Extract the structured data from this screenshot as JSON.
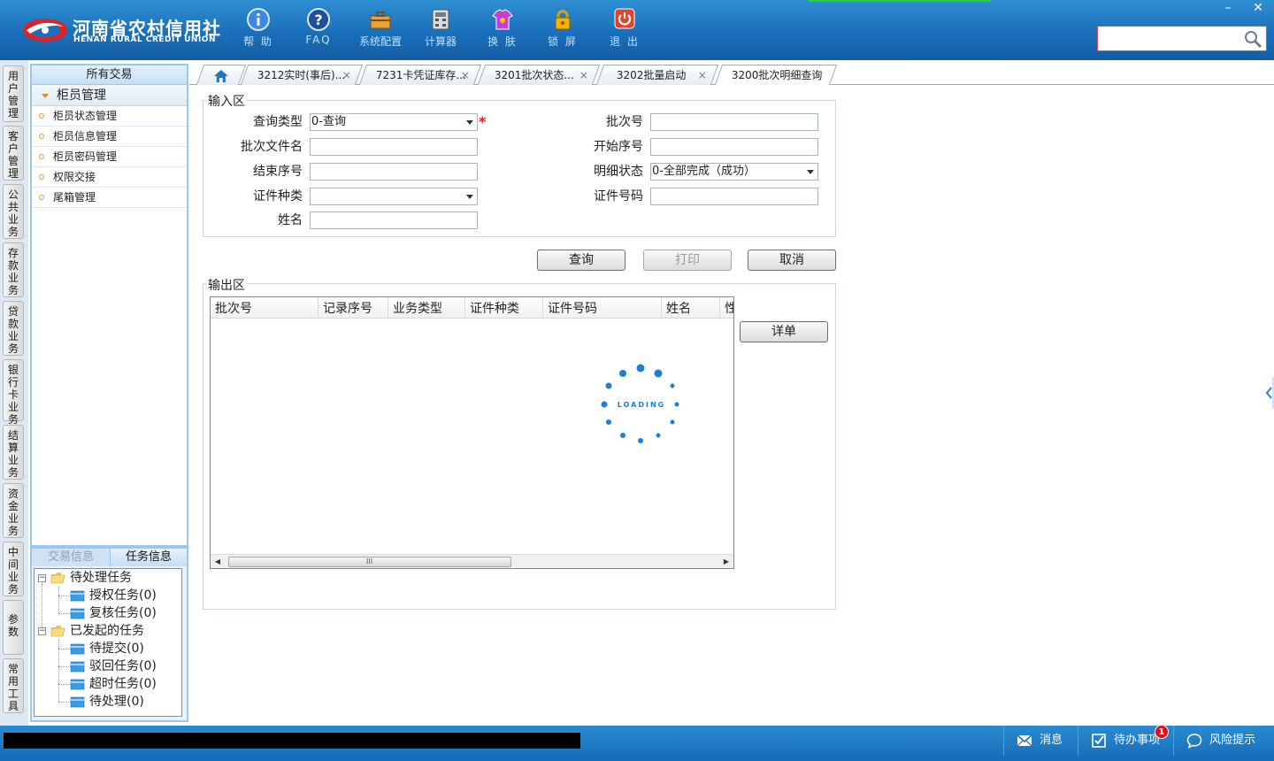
{
  "header": {
    "logo_cn": "河南省农村信用社",
    "logo_en": "HENAN RURAL CREDIT UNION",
    "tools": [
      {
        "label": "帮 助",
        "icon": "info-icon"
      },
      {
        "label": "FAQ",
        "icon": "help-question-icon"
      },
      {
        "label": "系统配置",
        "icon": "toolbox-icon"
      },
      {
        "label": "计算器",
        "icon": "calculator-icon"
      },
      {
        "label": "换 肤",
        "icon": "shirt-icon"
      },
      {
        "label": "锁 屏",
        "icon": "lock-icon"
      },
      {
        "label": "退 出",
        "icon": "power-icon"
      }
    ],
    "window_minimize": "–",
    "window_close": "✕",
    "search": {
      "value": "",
      "placeholder": ""
    }
  },
  "vertical_tabs": [
    "用户管理",
    "客户管理",
    "公共业务",
    "存款业务",
    "贷款业务",
    "银行卡业务",
    "结算业务",
    "资金业务",
    "中间业务",
    "参数",
    "常用工具"
  ],
  "sidebar": {
    "header": "所有交易",
    "group": "柜员管理",
    "items": [
      "柜员状态管理",
      "柜员信息管理",
      "柜员密码管理",
      "权限交接",
      "尾箱管理"
    ]
  },
  "taskpanel": {
    "tabs": [
      "交易信息",
      "任务信息"
    ],
    "active_tab": "任务信息",
    "tree": {
      "pending": {
        "label": "待处理任务",
        "children": [
          "授权任务(0)",
          "复核任务(0)"
        ]
      },
      "started": {
        "label": "已发起的任务",
        "children": [
          "待提交(0)",
          "驳回任务(0)",
          "超时任务(0)",
          "待处理(0)"
        ]
      }
    }
  },
  "tabs": [
    {
      "label": "",
      "icon": "home-icon"
    },
    {
      "label": "3212实时(事后)..."
    },
    {
      "label": "7231卡凭证库存..."
    },
    {
      "label": "3201批次状态..."
    },
    {
      "label": "3202批量启动"
    },
    {
      "label": "3200批次明细查询"
    }
  ],
  "tab_close": "×",
  "form": {
    "input_legend": "输入区",
    "output_legend": "输出区",
    "fields": {
      "query_type": {
        "label": "查询类型",
        "value": "0-查询",
        "required": "*"
      },
      "batch_no": {
        "label": "批次号",
        "value": ""
      },
      "batch_file": {
        "label": "批次文件名",
        "value": ""
      },
      "start_seq": {
        "label": "开始序号",
        "value": ""
      },
      "end_seq": {
        "label": "结束序号",
        "value": ""
      },
      "detail_status": {
        "label": "明细状态",
        "value": "0-全部完成（成功）"
      },
      "id_type": {
        "label": "证件种类",
        "value": ""
      },
      "id_no": {
        "label": "证件号码",
        "value": ""
      },
      "name": {
        "label": "姓名",
        "value": ""
      }
    },
    "buttons": {
      "query": "查询",
      "print": "打印",
      "cancel": "取消",
      "detail": "详单"
    }
  },
  "grid": {
    "columns": [
      "批次号",
      "记录序号",
      "业务类型",
      "证件种类",
      "证件号码",
      "姓名",
      "性"
    ],
    "scroll_grip": "III",
    "loading_text": "LOADING"
  },
  "statusbar": {
    "message": "",
    "buttons": [
      "消息",
      "待办事项",
      "风险提示"
    ],
    "todo_badge": "1"
  },
  "colors": {
    "header": "#1a6fba",
    "accent_required": "#e11111",
    "badge": "#d9131e"
  }
}
